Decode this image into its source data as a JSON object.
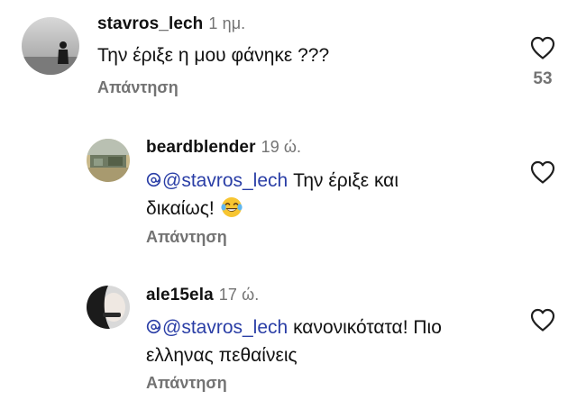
{
  "comments": [
    {
      "username": "stavros_lech",
      "time": "1 ημ.",
      "text": "Την έριξε η μου φάνηκε ???",
      "reply_label": "Απάντηση",
      "likes": "53"
    },
    {
      "username": "beardblender",
      "time": "19 ώ.",
      "mention": "@stavros_lech",
      "text_line1": "Την έριξε και",
      "text_line2": "δικαίως!",
      "reply_label": "Απάντηση"
    },
    {
      "username": "ale15ela",
      "time": "17 ώ.",
      "mention": "@stavros_lech",
      "text_line1": "κανονικότατα! Πιο",
      "text_line2": "ελληνας πεθαίνεις",
      "reply_label": "Απάντηση"
    }
  ],
  "icons": {
    "like": "heart-outline-icon",
    "mention": "threads-logo-icon",
    "emoji": "tears-of-joy-emoji"
  },
  "colors": {
    "mention": "#2a3ea6",
    "secondary_text": "#737373",
    "primary_text": "#111111"
  }
}
